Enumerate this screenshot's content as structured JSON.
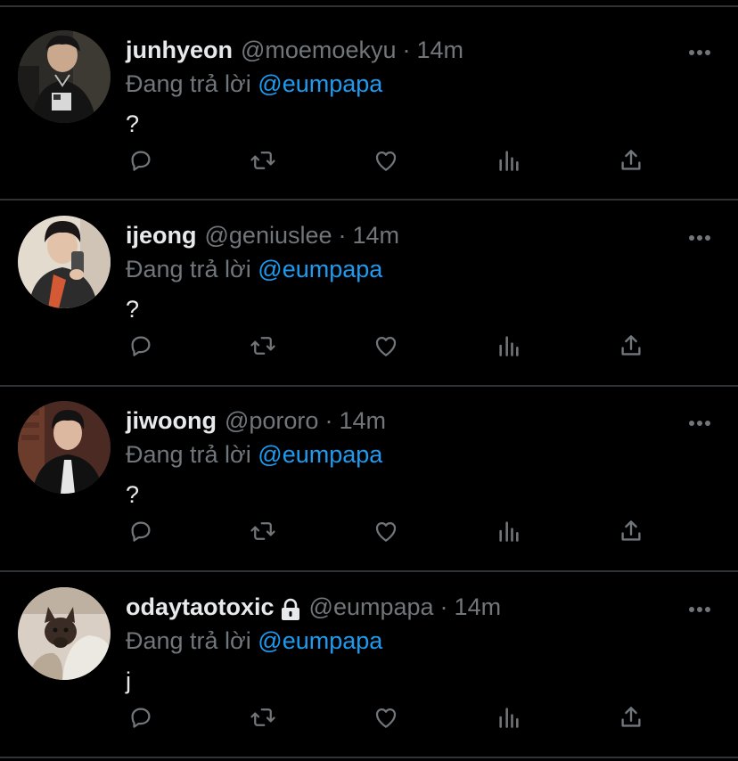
{
  "colors": {
    "background": "#000000",
    "divider": "#2f3336",
    "name": "#e7e9ea",
    "muted": "#71767b",
    "mention": "#1d9bf0",
    "icon": "#71767b"
  },
  "tweets": [
    {
      "display_name": "junhyeon",
      "handle": "@moemoekyu",
      "separator": "·",
      "time": "14m",
      "reply_prefix": "Đang trả lời",
      "reply_to": "@eumpapa",
      "text": "?",
      "locked": false
    },
    {
      "display_name": "ijeong",
      "handle": "@geniuslee",
      "separator": "·",
      "time": "14m",
      "reply_prefix": "Đang trả lời",
      "reply_to": "@eumpapa",
      "text": "?",
      "locked": false
    },
    {
      "display_name": "jiwoong",
      "handle": "@pororo",
      "separator": "·",
      "time": "14m",
      "reply_prefix": "Đang trả lời",
      "reply_to": "@eumpapa",
      "text": "?",
      "locked": false
    },
    {
      "display_name": "odaytaotoxic",
      "handle": "@eumpapa",
      "separator": "·",
      "time": "14m",
      "reply_prefix": "Đang trả lời",
      "reply_to": "@eumpapa",
      "text": "j",
      "locked": true
    }
  ],
  "actions": [
    "reply-icon",
    "retweet-icon",
    "like-icon",
    "views-icon",
    "share-icon"
  ]
}
